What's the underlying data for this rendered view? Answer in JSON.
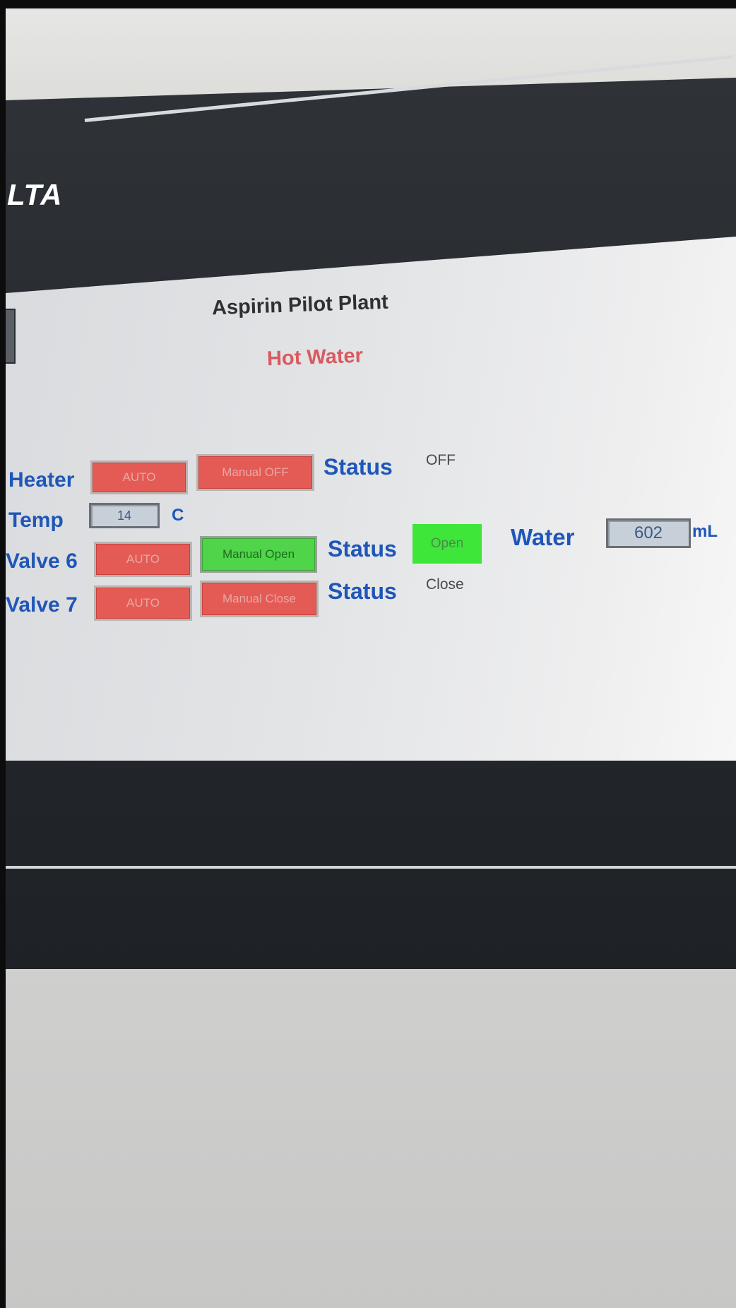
{
  "brand": "LTA",
  "hmi": {
    "title": "Aspirin Pilot Plant",
    "subtitle": "Hot Water",
    "heater": {
      "label": "Heater",
      "auto_label": "AUTO",
      "manual_label": "Manual OFF",
      "status_label": "Status",
      "status_value": "OFF"
    },
    "temp": {
      "label": "Temp",
      "value": "14",
      "unit": "C"
    },
    "valve6": {
      "label": "Valve 6",
      "auto_label": "AUTO",
      "manual_label": "Manual Open",
      "status_label": "Status",
      "status_value": "Open"
    },
    "valve7": {
      "label": "Valve 7",
      "auto_label": "AUTO",
      "manual_label": "Manual Close",
      "status_label": "Status",
      "status_value": "Close"
    },
    "water": {
      "label": "Water",
      "value": "602",
      "unit": "mL"
    }
  },
  "colors": {
    "label_blue": "#1f56b8",
    "alarm_red": "#e45b55",
    "active_green": "#3fe63a",
    "subtitle_red": "#d85a5f",
    "bezel": "#2a2e33"
  }
}
